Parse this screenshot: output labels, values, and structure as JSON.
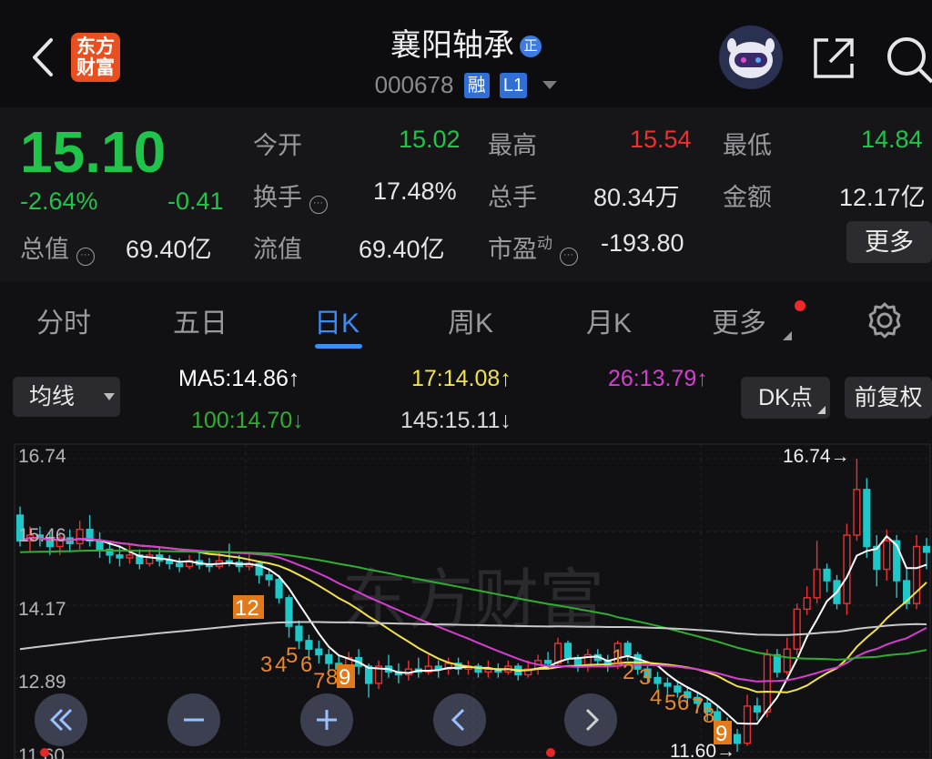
{
  "header": {
    "logo_line1": "东方",
    "logo_line2": "财富",
    "stock_name": "襄阳轴承",
    "name_badge": "正",
    "stock_code": "000678",
    "tag_margin": "融",
    "tag_level": "L1"
  },
  "quote": {
    "price": "15.10",
    "change_pct": "-2.64%",
    "change": "-0.41",
    "open_label": "今开",
    "open": "15.02",
    "high_label": "最高",
    "high": "15.54",
    "low_label": "最低",
    "low": "14.84",
    "turnover_label": "换手",
    "turnover": "17.48%",
    "volume_label": "总手",
    "volume": "80.34万",
    "amount_label": "金额",
    "amount": "12.17亿",
    "mktcap_label": "总值",
    "mktcap": "69.40亿",
    "float_label": "流值",
    "float": "69.40亿",
    "pe_label": "市盈",
    "pe_sup": "动",
    "pe": "-193.80",
    "more": "更多"
  },
  "tabs": [
    "分时",
    "五日",
    "日K",
    "周K",
    "月K",
    "更多"
  ],
  "ma_bar": {
    "selector": "均线",
    "ma5": "MA5:14.86↑",
    "ma17": "17:14.08↑",
    "ma26": "26:13.79↑",
    "ma100": "100:14.70↓",
    "ma145": "145:15.11↓",
    "dk_button": "DK点",
    "adjust_button": "前复权"
  },
  "colors": {
    "up": "#ec3131",
    "down": "#1fc8c8",
    "ma5": "#ffffff",
    "ma17": "#f2e24a",
    "ma26": "#d63dd0",
    "ma100": "#2fae2f",
    "ma145": "#c9c9c9",
    "accent": "#3b8cf5"
  },
  "chart_data": {
    "type": "candlestick",
    "y_ticks": [
      "16.74",
      "15.46",
      "14.17",
      "12.89",
      "11.60"
    ],
    "ylim": [
      11.6,
      16.74
    ],
    "max_label": "16.74→",
    "min_label": "11.60→",
    "watermark": "东方财富",
    "td_labels_a": [
      "12",
      "3",
      "4",
      "5",
      "6",
      "7",
      "8",
      "9"
    ],
    "td_labels_b": [
      "1",
      "2",
      "3",
      "4",
      "5",
      "6",
      "7",
      "8",
      "9"
    ],
    "candles": [
      [
        15.75,
        15.3,
        15.9,
        15.2
      ],
      [
        15.3,
        15.4,
        15.55,
        15.1
      ],
      [
        15.4,
        15.35,
        15.55,
        15.2
      ],
      [
        15.35,
        15.2,
        15.45,
        15.05
      ],
      [
        15.2,
        15.35,
        15.45,
        15.05
      ],
      [
        15.35,
        15.25,
        15.5,
        15.1
      ],
      [
        15.25,
        15.5,
        15.65,
        15.15
      ],
      [
        15.5,
        15.3,
        15.75,
        15.2
      ],
      [
        15.3,
        15.15,
        15.45,
        15.0
      ],
      [
        15.15,
        15.05,
        15.3,
        14.9
      ],
      [
        15.05,
        15.0,
        15.2,
        14.85
      ],
      [
        15.0,
        15.05,
        15.25,
        14.9
      ],
      [
        15.05,
        14.9,
        15.15,
        14.8
      ],
      [
        14.9,
        15.05,
        15.15,
        14.85
      ],
      [
        15.05,
        14.95,
        15.2,
        14.85
      ],
      [
        14.95,
        14.9,
        15.05,
        14.8
      ],
      [
        14.9,
        14.85,
        15.0,
        14.75
      ],
      [
        14.85,
        14.95,
        15.05,
        14.8
      ],
      [
        14.95,
        14.88,
        15.1,
        14.8
      ],
      [
        14.88,
        14.85,
        15.0,
        14.75
      ],
      [
        14.85,
        14.95,
        15.1,
        14.8
      ],
      [
        14.95,
        14.92,
        15.25,
        14.85
      ],
      [
        14.92,
        14.85,
        15.05,
        14.75
      ],
      [
        14.85,
        14.9,
        15.1,
        14.78
      ],
      [
        14.9,
        14.7,
        14.95,
        14.55
      ],
      [
        14.7,
        14.62,
        14.8,
        14.5
      ],
      [
        14.62,
        14.3,
        14.7,
        14.2
      ],
      [
        14.3,
        13.8,
        14.35,
        13.6
      ],
      [
        13.8,
        13.55,
        13.9,
        13.4
      ],
      [
        13.55,
        13.4,
        13.65,
        13.2
      ],
      [
        13.4,
        13.3,
        13.55,
        13.15
      ],
      [
        13.3,
        13.15,
        13.4,
        13.0
      ],
      [
        13.15,
        13.05,
        13.3,
        12.9
      ],
      [
        13.05,
        13.25,
        13.35,
        12.95
      ],
      [
        13.25,
        13.1,
        13.4,
        12.95
      ],
      [
        13.1,
        12.8,
        13.15,
        12.55
      ],
      [
        12.8,
        13.1,
        13.2,
        12.7
      ],
      [
        13.1,
        13.0,
        13.3,
        12.9
      ],
      [
        13.0,
        12.95,
        13.15,
        12.8
      ],
      [
        12.95,
        13.05,
        13.2,
        12.85
      ],
      [
        13.05,
        13.0,
        13.25,
        12.9
      ],
      [
        13.0,
        13.1,
        13.3,
        12.95
      ],
      [
        13.1,
        13.05,
        13.2,
        12.9
      ],
      [
        13.05,
        13.15,
        13.25,
        12.95
      ],
      [
        13.15,
        13.05,
        13.25,
        12.95
      ],
      [
        13.05,
        13.1,
        13.2,
        12.95
      ],
      [
        13.1,
        13.0,
        13.15,
        12.9
      ],
      [
        13.0,
        13.05,
        13.2,
        12.9
      ],
      [
        13.05,
        13.0,
        13.15,
        12.9
      ],
      [
        13.0,
        13.1,
        13.2,
        12.95
      ],
      [
        13.1,
        12.95,
        13.15,
        12.85
      ],
      [
        12.95,
        13.05,
        13.2,
        12.9
      ],
      [
        13.05,
        13.2,
        13.3,
        12.95
      ],
      [
        13.2,
        13.15,
        13.35,
        13.05
      ],
      [
        13.15,
        13.5,
        13.6,
        13.1
      ],
      [
        13.5,
        13.25,
        13.55,
        13.15
      ],
      [
        13.25,
        13.1,
        13.3,
        13.0
      ],
      [
        13.1,
        13.3,
        13.4,
        13.0
      ],
      [
        13.3,
        13.2,
        13.4,
        13.1
      ],
      [
        13.2,
        13.1,
        13.3,
        13.0
      ],
      [
        13.1,
        13.5,
        13.55,
        13.05
      ],
      [
        13.5,
        13.3,
        13.55,
        13.2
      ],
      [
        13.3,
        13.05,
        13.35,
        12.95
      ],
      [
        13.05,
        12.9,
        13.1,
        12.8
      ],
      [
        12.9,
        12.8,
        13.0,
        12.7
      ],
      [
        12.8,
        12.75,
        12.9,
        12.6
      ],
      [
        12.75,
        12.65,
        12.85,
        12.55
      ],
      [
        12.65,
        12.55,
        12.75,
        12.4
      ],
      [
        12.55,
        12.45,
        12.65,
        12.3
      ],
      [
        12.45,
        12.3,
        12.55,
        12.15
      ],
      [
        12.3,
        12.1,
        12.4,
        11.95
      ],
      [
        12.1,
        11.9,
        12.2,
        11.75
      ],
      [
        11.9,
        11.75,
        12.0,
        11.6
      ],
      [
        11.75,
        12.4,
        12.6,
        11.7
      ],
      [
        12.4,
        12.3,
        12.55,
        12.15
      ],
      [
        12.3,
        13.3,
        13.4,
        12.2
      ],
      [
        13.3,
        13.0,
        13.4,
        12.9
      ],
      [
        13.0,
        13.4,
        13.6,
        12.95
      ],
      [
        13.4,
        14.1,
        14.2,
        13.3
      ],
      [
        14.1,
        14.3,
        14.5,
        14.0
      ],
      [
        14.3,
        14.8,
        15.3,
        14.2
      ],
      [
        14.8,
        14.6,
        14.9,
        14.4
      ],
      [
        14.6,
        14.2,
        14.7,
        14.1
      ],
      [
        14.2,
        15.4,
        15.6,
        14.0
      ],
      [
        15.4,
        16.2,
        16.74,
        15.3
      ],
      [
        16.2,
        15.2,
        16.4,
        15.0
      ],
      [
        15.2,
        14.8,
        15.4,
        14.5
      ],
      [
        14.8,
        15.3,
        15.5,
        14.6
      ],
      [
        15.3,
        14.6,
        15.4,
        14.3
      ],
      [
        14.6,
        14.2,
        14.8,
        14.1
      ],
      [
        14.2,
        15.2,
        15.4,
        14.1
      ],
      [
        15.2,
        15.1,
        15.35,
        14.8
      ]
    ]
  }
}
